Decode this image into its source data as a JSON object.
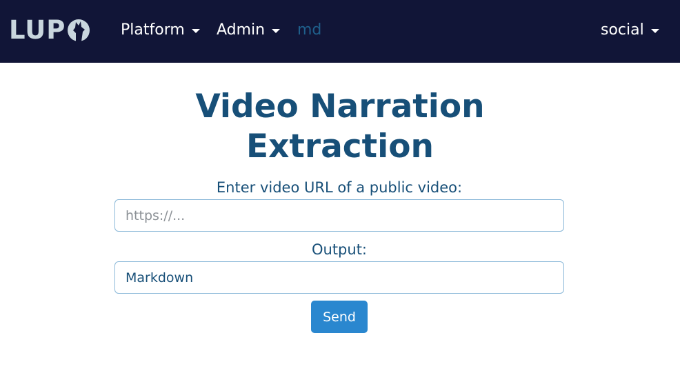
{
  "navbar": {
    "logo_text": "LUP",
    "items": [
      {
        "label": "Platform",
        "dropdown": true
      },
      {
        "label": "Admin",
        "dropdown": true
      },
      {
        "label": "md",
        "dropdown": false
      },
      {
        "label": "social",
        "dropdown": true
      }
    ]
  },
  "main": {
    "title": "Video Narration Extraction",
    "url_label": "Enter video URL of a public video:",
    "url_input": {
      "value": "",
      "placeholder": "https://..."
    },
    "output_label": "Output:",
    "output_selected": "Markdown",
    "send_label": "Send"
  },
  "colors": {
    "navbar_bg": "#111537",
    "logo": "#c9d6de",
    "heading": "#174f78",
    "button": "#2a87cf",
    "active_nav": "#1f5f8b"
  }
}
